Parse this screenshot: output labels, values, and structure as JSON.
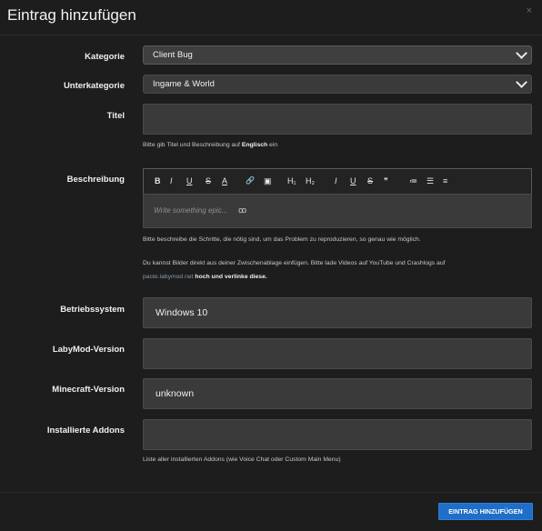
{
  "dialog": {
    "title": "Eintrag hinzufügen",
    "close_symbol": "×"
  },
  "form": {
    "kategorie": {
      "label": "Kategorie",
      "value": "Client Bug"
    },
    "unterkategorie": {
      "label": "Unterkategorie",
      "value": "Ingame & World"
    },
    "titel": {
      "label": "Titel",
      "value": "",
      "help_prefix": "Bitte gib Titel und Beschreibung auf ",
      "help_bold": "Englisch",
      "help_suffix": " ein"
    },
    "beschreibung": {
      "label": "Beschreibung",
      "placeholder": "Write something epic...",
      "placeholder_glyph": "ꝏ",
      "help_1": "Bitte beschreibe die Schritte, die nötig sind, um das Problem zu reproduzieren, so genau wie möglich.",
      "help_2a": "Du kannst Bilder direkt aus deiner Zwischenablage einfügen. Bitte lade Videos auf YouTube und Crashlogs auf",
      "help_2_link": "paste.labymod.net",
      "help_2b": " hoch und verlinke diese."
    },
    "betriebssystem": {
      "label": "Betriebssystem",
      "value": "Windows 10"
    },
    "labymod_version": {
      "label": "LabyMod-Version",
      "value": ""
    },
    "minecraft_version": {
      "label": "Minecraft-Version",
      "value": "unknown"
    },
    "installierte_addons": {
      "label": "Installierte Addons",
      "value": "",
      "help": "Liste aller installierten Addons (wie Voice Chat oder Custom Main Menu)"
    }
  },
  "toolbar": {
    "bold": "B",
    "italic": "I",
    "underline": "U",
    "strike": "S",
    "color": "A",
    "link": "🔗",
    "image": "▣",
    "h1": "H₁",
    "h2": "H₂",
    "italic2": "I",
    "underline2": "U",
    "strike2": "S",
    "quote": "❞",
    "ordered_list": "≔",
    "bullet_list": "☰",
    "align": "≡"
  },
  "footer": {
    "submit_label": "EINTRAG HINZUFÜGEN"
  },
  "colors": {
    "accent": "#1f6fc8",
    "background": "#1d1d1d",
    "field": "#3a3a3a"
  }
}
